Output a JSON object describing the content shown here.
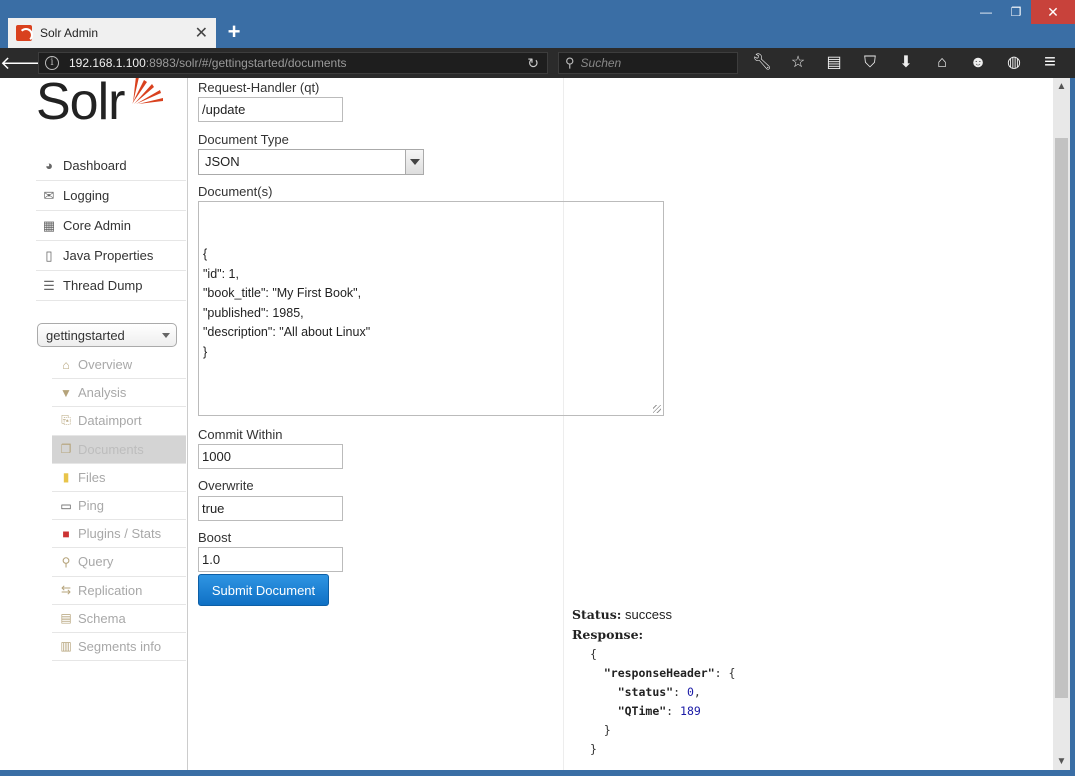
{
  "browser": {
    "tab_title": "Solr Admin",
    "url_host": "192.168.1.100",
    "url_path": ":8983/solr/#/gettingstarted/documents",
    "search_placeholder": "Suchen",
    "window_buttons": [
      "—",
      "❐",
      "✕"
    ],
    "toolbar_icons": [
      "wrench-icon",
      "star-icon",
      "reading-list-icon",
      "pocket-icon",
      "download-icon",
      "home-icon",
      "smiley-icon",
      "globe-icon"
    ]
  },
  "sidebar": {
    "logo_text": "Solr",
    "main_nav": [
      {
        "label": "Dashboard",
        "icon": "dashboard-icon"
      },
      {
        "label": "Logging",
        "icon": "logging-icon"
      },
      {
        "label": "Core Admin",
        "icon": "core-admin-icon"
      },
      {
        "label": "Java Properties",
        "icon": "java-properties-icon"
      },
      {
        "label": "Thread Dump",
        "icon": "thread-dump-icon"
      }
    ],
    "core_selector": "gettingstarted",
    "core_nav": [
      {
        "label": "Overview",
        "icon": "home-icon"
      },
      {
        "label": "Analysis",
        "icon": "filter-icon"
      },
      {
        "label": "Dataimport",
        "icon": "dataimport-icon"
      },
      {
        "label": "Documents",
        "icon": "documents-icon",
        "active": true
      },
      {
        "label": "Files",
        "icon": "files-icon"
      },
      {
        "label": "Ping",
        "icon": "ping-icon"
      },
      {
        "label": "Plugins / Stats",
        "icon": "plugins-icon"
      },
      {
        "label": "Query",
        "icon": "query-icon"
      },
      {
        "label": "Replication",
        "icon": "replication-icon"
      },
      {
        "label": "Schema",
        "icon": "schema-icon"
      },
      {
        "label": "Segments info",
        "icon": "segments-icon"
      }
    ]
  },
  "form": {
    "handler_label": "Request-Handler (qt)",
    "handler_value": "/update",
    "doctype_label": "Document Type",
    "doctype_value": "JSON",
    "documents_label": "Document(s)",
    "documents_value": "{\n\"id\": 1,\n\"book_title\": \"My First Book\",\n\"published\": 1985,\n\"description\": \"All about Linux\"\n}",
    "commit_label": "Commit Within",
    "commit_value": "1000",
    "overwrite_label": "Overwrite",
    "overwrite_value": "true",
    "boost_label": "Boost",
    "boost_value": "1.0",
    "submit_label": "Submit Document"
  },
  "response": {
    "status_label": "Status:",
    "status_value": "success",
    "response_label": "Response:",
    "open_brace": "{",
    "header_key": "\"responseHeader\"",
    "status_key": "\"status\"",
    "status_num": "0",
    "qtime_key": "\"QTime\"",
    "qtime_num": "189",
    "inner_close": "}",
    "outer_close": "}"
  }
}
